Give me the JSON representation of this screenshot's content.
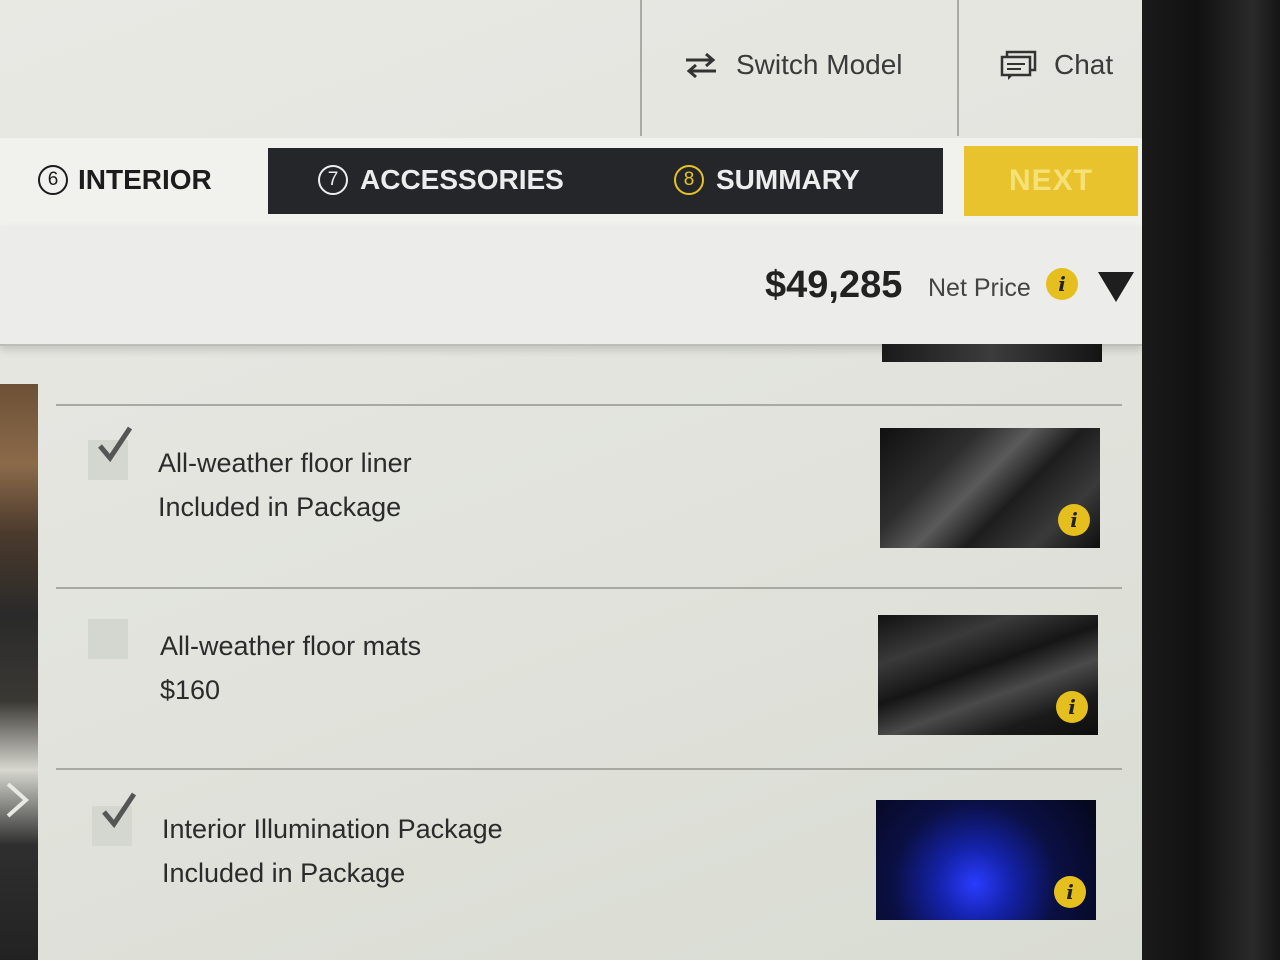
{
  "header": {
    "switch_model_label": "Switch Model",
    "chat_label": "Chat"
  },
  "steps": [
    {
      "number": "6",
      "label": "INTERIOR"
    },
    {
      "number": "7",
      "label": "ACCESSORIES"
    },
    {
      "number": "8",
      "label": "SUMMARY"
    }
  ],
  "next_label": "NEXT",
  "price": {
    "amount": "$49,285",
    "label": "Net Price",
    "info_glyph": "i"
  },
  "items": [
    {
      "name": "All-weather floor liner",
      "detail": "Included in Package",
      "checked": true,
      "info_glyph": "i"
    },
    {
      "name": "All-weather floor mats",
      "detail": "$160",
      "checked": false,
      "info_glyph": "i"
    },
    {
      "name": "Interior Illumination Package",
      "detail": "Included in Package",
      "checked": true,
      "info_glyph": "i"
    }
  ],
  "colors": {
    "accent_yellow": "#e9c32d",
    "step_bar_dark": "#25262a"
  },
  "icons": [
    "switch-arrows-icon",
    "chat-icon",
    "info-icon",
    "caret-down-icon",
    "checkmark-icon",
    "chevron-left-icon"
  ]
}
